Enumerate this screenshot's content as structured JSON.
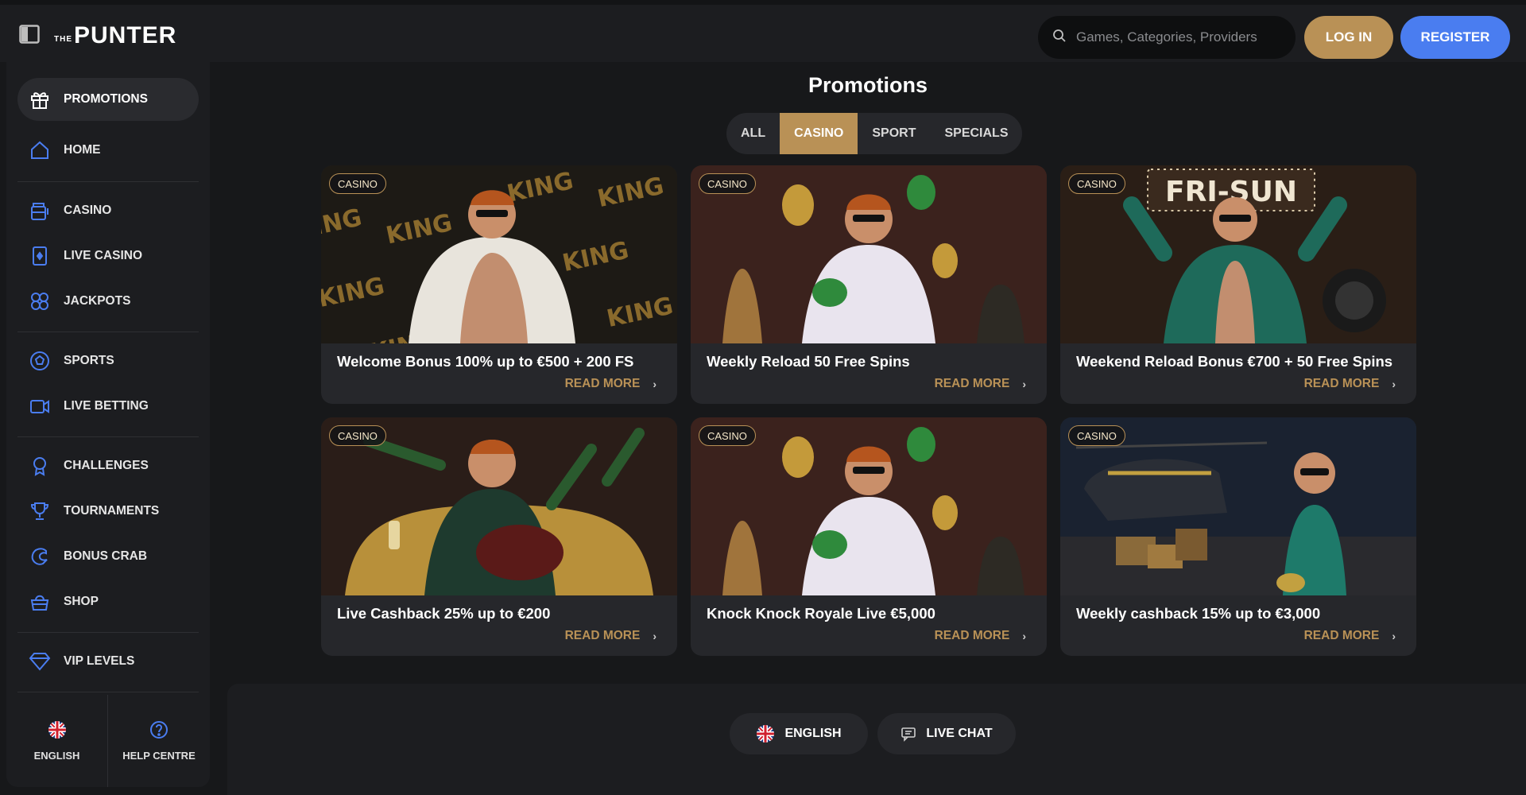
{
  "header": {
    "logo_the": "THE",
    "logo_name": "PUNTER",
    "search_placeholder": "Games, Categories, Providers",
    "login_label": "LOG IN",
    "register_label": "REGISTER"
  },
  "sidebar": {
    "items": [
      {
        "label": "PROMOTIONS",
        "icon": "gift-icon",
        "active": true
      },
      {
        "label": "HOME",
        "icon": "home-icon"
      },
      {
        "label": "CASINO",
        "icon": "slot-machine-icon"
      },
      {
        "label": "LIVE CASINO",
        "icon": "playing-card-icon"
      },
      {
        "label": "JACKPOTS",
        "icon": "clover-icon"
      },
      {
        "label": "SPORTS",
        "icon": "soccer-ball-icon"
      },
      {
        "label": "LIVE BETTING",
        "icon": "video-camera-icon"
      },
      {
        "label": "CHALLENGES",
        "icon": "award-ribbon-icon"
      },
      {
        "label": "TOURNAMENTS",
        "icon": "trophy-icon"
      },
      {
        "label": "BONUS CRAB",
        "icon": "crab-claw-icon"
      },
      {
        "label": "SHOP",
        "icon": "shopping-basket-icon"
      },
      {
        "label": "VIP LEVELS",
        "icon": "diamond-icon"
      }
    ],
    "footer": {
      "language_label": "ENGLISH",
      "help_label": "HELP CENTRE"
    }
  },
  "main": {
    "title": "Promotions",
    "tabs": [
      "ALL",
      "CASINO",
      "SPORT",
      "SPECIALS"
    ],
    "active_tab": "CASINO",
    "read_more": "READ MORE",
    "cards": [
      {
        "badge": "CASINO",
        "title": "Welcome Bonus 100% up to €500 + 200 FS",
        "image_text": "KING"
      },
      {
        "badge": "CASINO",
        "title": "Weekly Reload 50 Free Spins"
      },
      {
        "badge": "CASINO",
        "title": "Weekend Reload Bonus €700 + 50 Free Spins",
        "image_text": "FRI-SUN"
      },
      {
        "badge": "CASINO",
        "title": "Live Cashback 25% up to €200"
      },
      {
        "badge": "CASINO",
        "title": "Knock Knock Royale Live €5,000"
      },
      {
        "badge": "CASINO",
        "title": "Weekly cashback 15% up to €3,000"
      }
    ]
  },
  "footer": {
    "language_label": "ENGLISH",
    "chat_label": "LIVE CHAT"
  },
  "colors": {
    "background": "#17181a",
    "panel": "#1c1d20",
    "card": "#26272b",
    "gold_accent": "#b99156",
    "blue_accent": "#4a7df0"
  }
}
